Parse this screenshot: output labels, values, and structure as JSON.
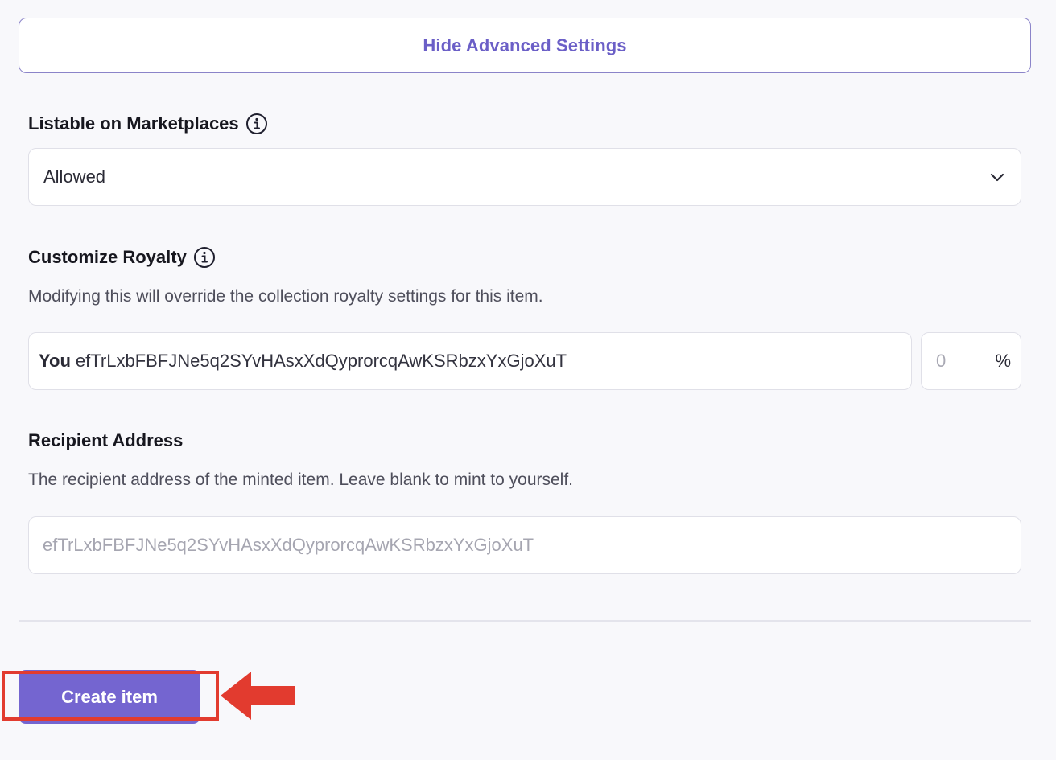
{
  "advanced": {
    "toggle_label": "Hide Advanced Settings"
  },
  "listable": {
    "label": "Listable on Marketplaces",
    "selected": "Allowed"
  },
  "royalty": {
    "label": "Customize Royalty",
    "help": "Modifying this will override the collection royalty settings for this item.",
    "you_label": "You",
    "address": "efTrLxbFBFJNe5q2SYvHAsxXdQyprorcqAwKSRbzxYxGjoXuT",
    "percent_placeholder": "0",
    "percent_sign": "%"
  },
  "recipient": {
    "label": "Recipient Address",
    "help": "The recipient address of the minted item. Leave blank to mint to yourself.",
    "placeholder": "efTrLxbFBFJNe5q2SYvHAsxXdQyprorcqAwKSRbzxYxGjoXuT"
  },
  "actions": {
    "create_label": "Create item"
  },
  "colors": {
    "accent": "#7465d0",
    "accent_text": "#6b5fc7",
    "annotation": "#e23b2f",
    "background": "#f8f8fb"
  },
  "icons": {
    "info": "info-circle-icon",
    "chevron": "chevron-down-icon",
    "pointer": "arrow-left-icon"
  }
}
